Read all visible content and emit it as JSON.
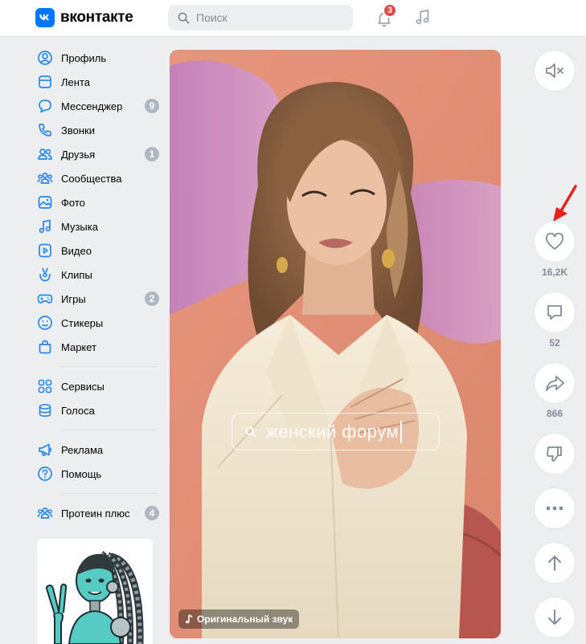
{
  "header": {
    "logo_text": "вконтакте",
    "search_placeholder": "Поиск",
    "notifications_count": "3"
  },
  "sidebar": {
    "items": [
      {
        "label": "Профиль",
        "icon": "profile-icon",
        "badge": ""
      },
      {
        "label": "Лента",
        "icon": "feed-icon",
        "badge": ""
      },
      {
        "label": "Мессенджер",
        "icon": "messenger-icon",
        "badge": "9"
      },
      {
        "label": "Звонки",
        "icon": "phone-icon",
        "badge": ""
      },
      {
        "label": "Друзья",
        "icon": "friends-icon",
        "badge": "1"
      },
      {
        "label": "Сообщества",
        "icon": "communities-icon",
        "badge": ""
      },
      {
        "label": "Фото",
        "icon": "photo-icon",
        "badge": ""
      },
      {
        "label": "Музыка",
        "icon": "music-icon",
        "badge": ""
      },
      {
        "label": "Видео",
        "icon": "video-icon",
        "badge": ""
      },
      {
        "label": "Клипы",
        "icon": "clips-icon",
        "badge": ""
      },
      {
        "label": "Игры",
        "icon": "gamepad-icon",
        "badge": "2"
      },
      {
        "label": "Стикеры",
        "icon": "smile-icon",
        "badge": ""
      },
      {
        "label": "Маркет",
        "icon": "bag-icon",
        "badge": ""
      }
    ],
    "group2": [
      {
        "label": "Сервисы",
        "icon": "services-icon"
      },
      {
        "label": "Голоса",
        "icon": "coins-icon"
      }
    ],
    "group3": [
      {
        "label": "Реклама",
        "icon": "megaphone-icon"
      },
      {
        "label": "Помощь",
        "icon": "help-icon"
      }
    ],
    "group4": [
      {
        "label": "Протеин плюс",
        "icon": "communities-icon",
        "badge": "4"
      }
    ]
  },
  "video": {
    "overlay_search_text": "женский форум",
    "sound_label": "Оригинальный звук"
  },
  "actions": {
    "likes": "16,2K",
    "comments": "52",
    "shares": "866"
  },
  "colors": {
    "accent": "#0077ff",
    "icon": "#2688eb",
    "badge": "#aeb7c2",
    "notification": "#e64646",
    "annotation_arrow": "#e8211a"
  }
}
